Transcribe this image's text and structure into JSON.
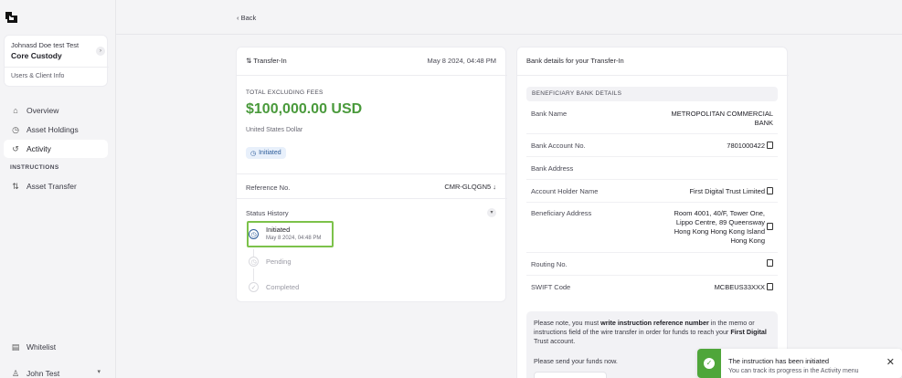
{
  "sidebar": {
    "account": {
      "name": "Johnasd Doe test Test",
      "org": "Core Custody",
      "link": "Users & Client Info",
      "chevron": "›"
    },
    "items": [
      {
        "label": "Overview",
        "icon": "⌂",
        "icon_name": "home-icon"
      },
      {
        "label": "Asset Holdings",
        "icon": "◷",
        "icon_name": "holdings-icon"
      },
      {
        "label": "Activity",
        "icon": "↺",
        "icon_name": "activity-icon"
      }
    ],
    "section_label": "INSTRUCTIONS",
    "instructions_items": [
      {
        "label": "Asset Transfer",
        "icon": "⇅",
        "icon_name": "transfer-icon"
      }
    ],
    "whitelist": {
      "label": "Whitelist",
      "icon": "▤"
    },
    "user": {
      "label": "John Test",
      "icon": "♙",
      "caret": "▾"
    }
  },
  "topbar": {
    "back_label": "‹  Back"
  },
  "transfer": {
    "title": "⇅ Transfer-In",
    "date": "May 8 2024, 04:48 PM",
    "total_label": "TOTAL EXCLUDING FEES",
    "amount": "$100,000.00 USD",
    "currency_name": "United States Dollar",
    "status_badge": "Initiated",
    "reference_label": "Reference No.",
    "reference_value": "CMR-GLQGN5  ↓",
    "status_history_label": "Status History",
    "history": [
      {
        "title": "Initiated",
        "date": "May 8 2024, 04:48 PM",
        "state": "current"
      },
      {
        "title": "Pending",
        "date": "",
        "state": "upcoming"
      },
      {
        "title": "Completed",
        "date": "",
        "state": "upcoming"
      }
    ]
  },
  "bank": {
    "title": "Bank details for your Transfer-In",
    "section": "BENEFICIARY BANK DETAILS",
    "rows": [
      {
        "label": "Bank Name",
        "value": "METROPOLITAN COMMERCIAL BANK",
        "copy": false
      },
      {
        "label": "Bank Account No.",
        "value": "7801000422",
        "copy": true
      },
      {
        "label": "Bank Address",
        "value": "",
        "copy": false
      },
      {
        "label": "Account Holder Name",
        "value": "First Digital Trust Limited",
        "copy": true
      },
      {
        "label": "Beneficiary Address",
        "value": "Room 4001, 40/F, Tower One, Lippo Centre, 89 Queensway Hong Kong Hong Kong Island Hong Kong",
        "copy": true
      },
      {
        "label": "Routing No.",
        "value": "",
        "copy": true
      },
      {
        "label": "SWIFT Code",
        "value": "MCBEUS33XXX",
        "copy": true
      }
    ],
    "note_pre": "Please note, you must ",
    "note_bold": "write instruction reference number",
    "note_mid": " in the memo or instructions field of the wire transfer in order for funds to reach your ",
    "note_bold2": "First Digital",
    "note_post": " Trust account.",
    "note_send": "Please send your funds now."
  },
  "toast": {
    "title": "The instruction has been initiated",
    "subtitle": "You can track its progress in the Activity menu",
    "close": "✕"
  },
  "colors": {
    "accent_green": "#4a9a3c",
    "highlight": "#7cc24a",
    "badge_bg": "#e8f0fb"
  }
}
